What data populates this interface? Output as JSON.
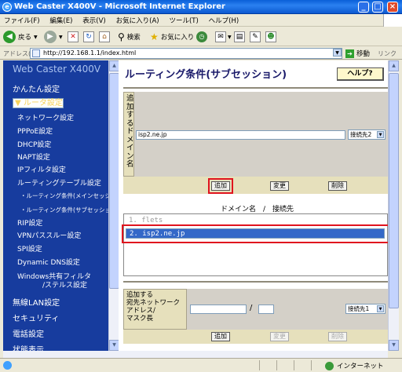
{
  "window": {
    "title": "Web Caster X400V - Microsoft Internet Explorer",
    "min": "_",
    "max": "□",
    "close": "×"
  },
  "menu": [
    "ファイル(F)",
    "編集(E)",
    "表示(V)",
    "お気に入り(A)",
    "ツール(T)",
    "ヘルプ(H)"
  ],
  "toolbar": {
    "back": "戻る",
    "search": "検索",
    "favorites": "お気に入り"
  },
  "address": {
    "label": "アドレス(D)",
    "url": "http://192.168.1.1/index.html",
    "go": "移動",
    "links": "リンク"
  },
  "sidebar": {
    "brand": "Web Caster X400V",
    "items": [
      "かんたん設定",
      "▼ ルータ設定",
      "ネットワーク設定",
      "PPPoE設定",
      "DHCP設定",
      "NAPT設定",
      "IPフィルタ設定",
      "ルーティングテーブル設定",
      "・ルーティング条件(メインセッション)",
      "・ルーティング条件(サブセッション)",
      "RIP設定",
      "VPNパススルー設定",
      "SPI設定",
      "Dynamic DNS設定",
      "Windows共有フィルタ",
      "/ステルス設定",
      "無線LAN設定",
      "セキュリティ",
      "電話設定",
      "状態表示"
    ]
  },
  "main": {
    "title": "ルーティング条件(サブセッション)",
    "help": "ヘルプ?",
    "domain_label": "追加するドメイン名",
    "domain_value": "isp2.ne.jp",
    "destination_select": "接続先2",
    "buttons": {
      "add": "追加",
      "change": "変更",
      "delete": "削除"
    },
    "list_header": "ドメイン名　/　接続先",
    "list_items": [
      "1. flets",
      "2. isp2.ne.jp"
    ],
    "network_label_lines": [
      "追加する",
      "宛先ネットワーク",
      "アドレス/",
      "マスク長"
    ],
    "slash": "/",
    "network_select": "接続先1",
    "buttons2": {
      "add": "追加",
      "change": "変更",
      "delete": "削除"
    }
  },
  "status": {
    "zone": "インターネット"
  }
}
